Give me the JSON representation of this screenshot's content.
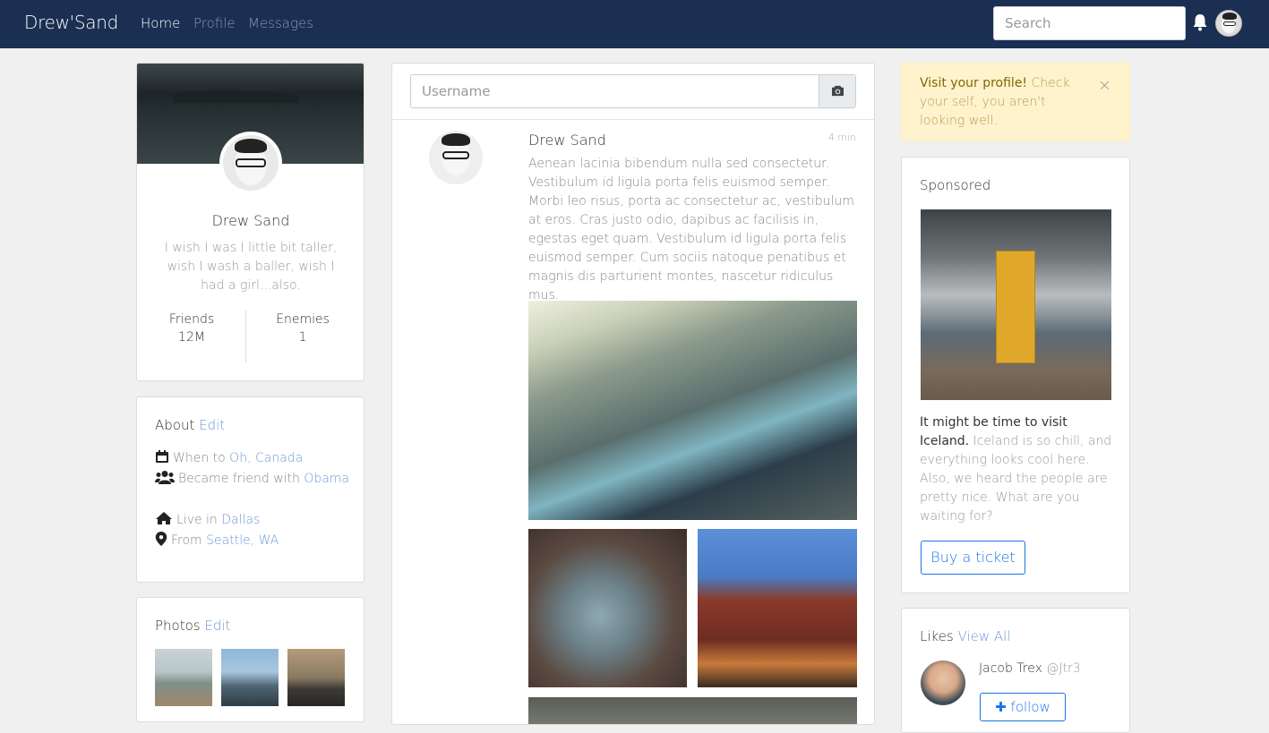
{
  "navbar": {
    "brand": "Drew'Sand",
    "links": [
      "Home",
      "Profile",
      "Messages"
    ],
    "search_placeholder": "Search"
  },
  "profile": {
    "name": "Drew Sand",
    "bio": "I wish I was I little bit taller, wish I wash a baller, wish I had a girl...also.",
    "stats": [
      {
        "label": "Friends",
        "value": "12M"
      },
      {
        "label": "Enemies",
        "value": "1"
      }
    ]
  },
  "about": {
    "title": "About",
    "edit": "Edit",
    "items": [
      {
        "icon": "calendar-icon",
        "text": "When to",
        "link": "Oh, Canada"
      },
      {
        "icon": "users-icon",
        "text": "Became friend with",
        "link": "Obama"
      },
      {
        "icon": "home-icon",
        "text": "Live in",
        "link": "Dallas"
      },
      {
        "icon": "map-pin-icon",
        "text": "From",
        "link": "Seattle, WA"
      }
    ]
  },
  "photos": {
    "title": "Photos",
    "edit": "Edit"
  },
  "composer": {
    "placeholder": "Username"
  },
  "post": {
    "author": "Drew Sand",
    "time": "4 min",
    "text": "Aenean lacinia bibendum nulla sed consectetur. Vestibulum id ligula porta felis euismod semper. Morbi leo risus, porta ac consectetur ac, vestibulum at eros. Cras justo odio, dapibus ac facilisis in, egestas eget quam. Vestibulum id ligula porta felis euismod semper. Cum sociis natoque penatibus et magnis dis parturient montes, nascetur ridiculus mus."
  },
  "alert": {
    "strong": "Visit your profile!",
    "text": "Check your self, you aren't looking well.",
    "close": "×"
  },
  "sponsored": {
    "title": "Sponsored",
    "strong": "It might be time to visit Iceland.",
    "text": "Iceland is so chill, and everything looks cool here. Also, we heard the people are pretty nice. What are you waiting for?",
    "button": "Buy a ticket"
  },
  "likes": {
    "title": "Likes",
    "view_all": "View All",
    "user_name": "Jacob Trex",
    "user_handle": "@Jtr3",
    "follow": "follow"
  },
  "colors": {
    "navbar": "#1a2f52",
    "link": "#6e9ad4",
    "button_outline": "#1a73e8",
    "alert_bg": "#fff3cd"
  }
}
